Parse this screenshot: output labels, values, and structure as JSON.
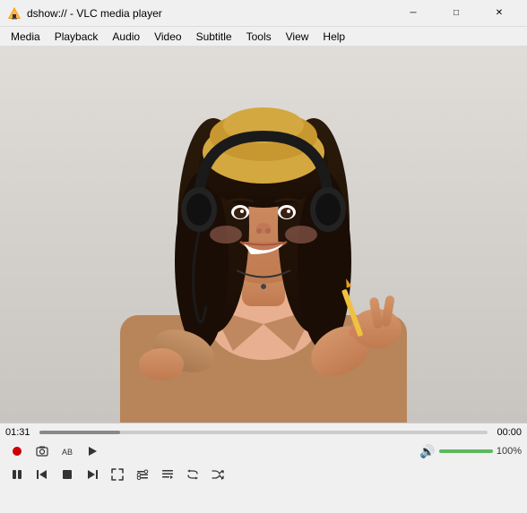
{
  "titleBar": {
    "title": "dshow:// - VLC media player",
    "minimizeLabel": "─",
    "maximizeLabel": "□",
    "closeLabel": "✕"
  },
  "menuBar": {
    "items": [
      "Media",
      "Playback",
      "Audio",
      "Video",
      "Subtitle",
      "Tools",
      "View",
      "Help"
    ]
  },
  "controls": {
    "currentTime": "01:31",
    "totalTime": "00:00",
    "progressPercent": 18,
    "volumePercent": 100,
    "volumeLabel": "100%"
  }
}
